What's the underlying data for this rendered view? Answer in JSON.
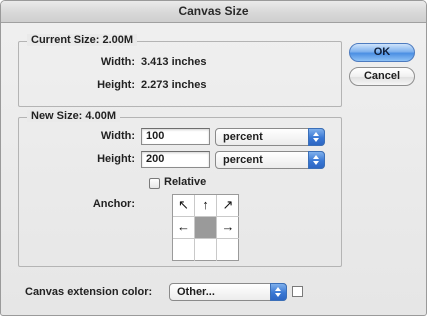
{
  "window": {
    "title": "Canvas Size"
  },
  "current_size": {
    "legend": "Current Size: 2.00M",
    "width_label": "Width:",
    "width_value": "3.413 inches",
    "height_label": "Height:",
    "height_value": "2.273 inches"
  },
  "new_size": {
    "legend": "New Size: 4.00M",
    "width_label": "Width:",
    "width_value": "100",
    "width_unit": "percent",
    "height_label": "Height:",
    "height_value": "200",
    "height_unit": "percent",
    "relative_label": "Relative",
    "relative_checked": false,
    "anchor_label": "Anchor:",
    "anchor_arrows": [
      "↖",
      "↑",
      "↗",
      "←",
      "",
      "→",
      "",
      "",
      ""
    ]
  },
  "extension": {
    "label": "Canvas extension color:",
    "value": "Other...",
    "swatch_color": "#ffffff"
  },
  "buttons": {
    "ok": "OK",
    "cancel": "Cancel"
  },
  "colors": {
    "accent": "#4b8fe3",
    "anchor_center": "#9a9a9a"
  }
}
